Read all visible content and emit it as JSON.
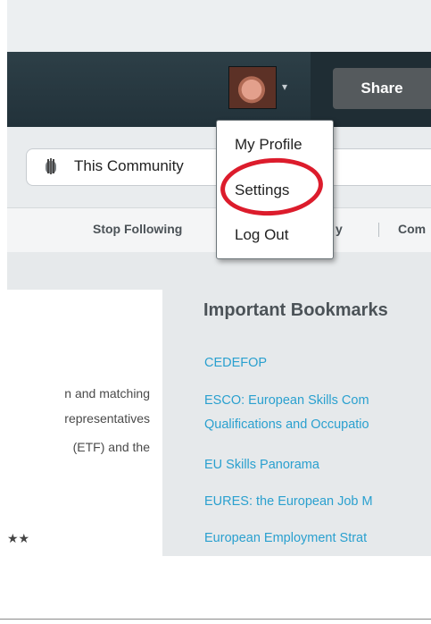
{
  "header": {
    "share_label": "Share",
    "avatar_caret": "▾"
  },
  "search": {
    "scope_label": "This Community",
    "scope_icon": "community-icon"
  },
  "nav": {
    "stop_following": "Stop Following",
    "history_partial": "y",
    "community_partial": "Com"
  },
  "user_menu": {
    "items": [
      {
        "label": "My Profile"
      },
      {
        "label": "Settings",
        "highlighted": true,
        "highlight_color": "#dc1c2c"
      },
      {
        "label": "Log Out"
      }
    ]
  },
  "main": {
    "body_lines": [
      "n and matching",
      "representatives",
      "(ETF) and the"
    ],
    "stars": "★★"
  },
  "bookmarks": {
    "heading": "Important Bookmarks",
    "links": [
      "CEDEFOP",
      "ESCO: European Skills Com",
      "Qualifications and Occupatio",
      "EU Skills Panorama",
      "EURES: the European Job M",
      "European Employment Strat"
    ],
    "link_color": "#2aa0cf"
  }
}
